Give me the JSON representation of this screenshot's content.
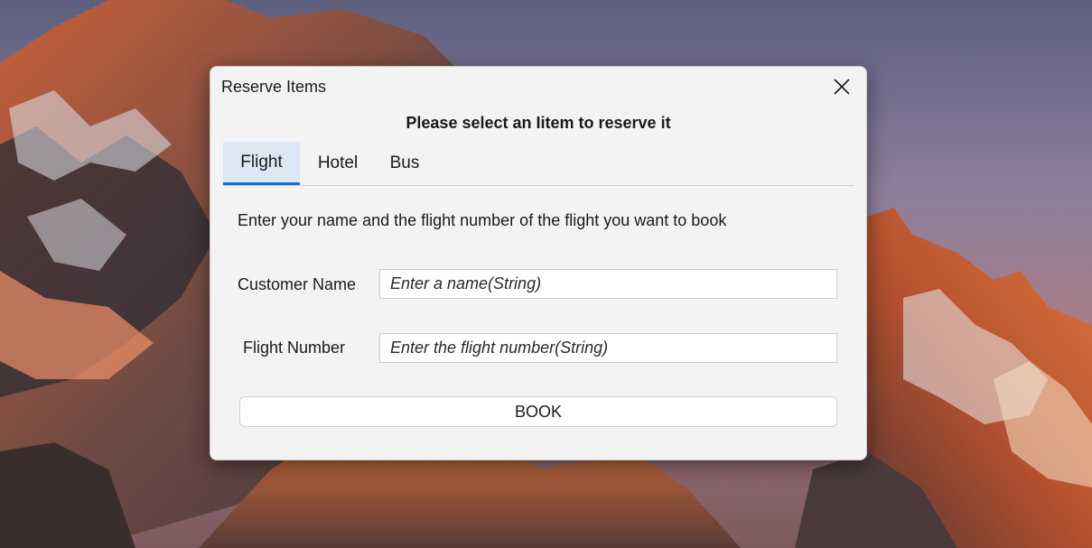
{
  "window": {
    "title": "Reserve Items"
  },
  "dialog": {
    "heading": "Please select an Iitem to reserve it"
  },
  "tabs": [
    {
      "label": "Flight",
      "active": true
    },
    {
      "label": "Hotel",
      "active": false
    },
    {
      "label": "Bus",
      "active": false
    }
  ],
  "flight_form": {
    "instruction": "Enter your name and the flight number of the flight you want to book",
    "customer_name": {
      "label": "Customer Name",
      "value": "",
      "placeholder": "Enter a name(String)"
    },
    "flight_number": {
      "label": "Flight Number",
      "value": "",
      "placeholder": "Enter the flight number(String)"
    },
    "book_label": "BOOK"
  },
  "icons": {
    "close": "close-icon"
  },
  "colors": {
    "accent": "#0a70e0",
    "active_tab_bg": "#dde7f3",
    "dialog_bg": "#f3f3f3"
  }
}
